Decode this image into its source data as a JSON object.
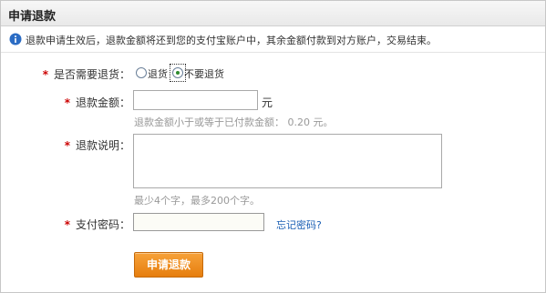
{
  "header": {
    "title": "申请退款"
  },
  "notice": {
    "text": "退款申请生效后，退款金额将还到您的支付宝账户中，其余金额付款到对方账户，交易结束。"
  },
  "form": {
    "return_goods": {
      "label": "是否需要退货：",
      "options": [
        "退货",
        "不要退货"
      ],
      "selected": "不要退货"
    },
    "amount": {
      "label": "退款金额：",
      "value": "",
      "unit": "元",
      "hint": "退款金额小于或等于已付款金额： 0.20 元。"
    },
    "reason": {
      "label": "退款说明：",
      "value": "",
      "hint": "最少4个字，最多200个字。"
    },
    "password": {
      "label": "支付密码：",
      "value": "",
      "forgot_link": "忘记密码?"
    },
    "submit_label": "申请退款"
  },
  "colors": {
    "required_asterisk": "#cc0000",
    "submit_button": "#f08a1c",
    "link": "#1a5fb4",
    "info_icon": "#2b6cc4"
  }
}
